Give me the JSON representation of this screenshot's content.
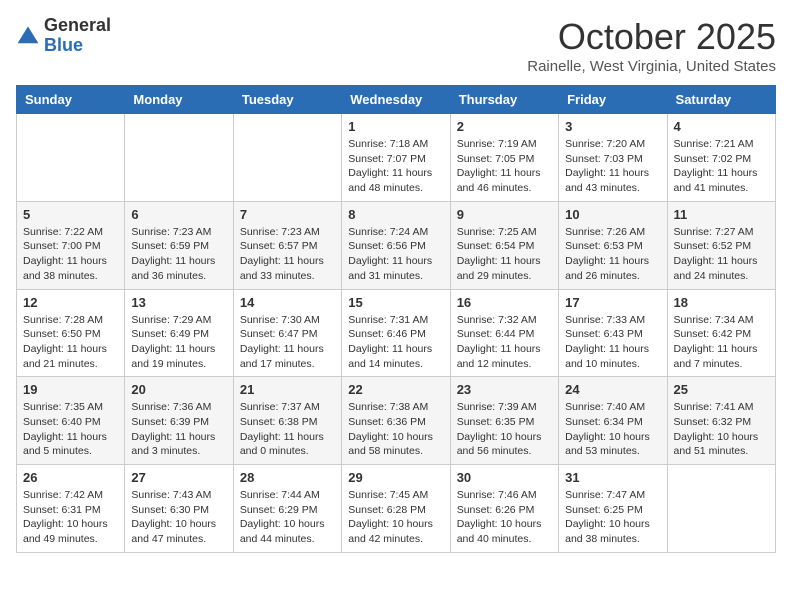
{
  "logo": {
    "general": "General",
    "blue": "Blue"
  },
  "title": "October 2025",
  "location": "Rainelle, West Virginia, United States",
  "days_of_week": [
    "Sunday",
    "Monday",
    "Tuesday",
    "Wednesday",
    "Thursday",
    "Friday",
    "Saturday"
  ],
  "weeks": [
    [
      {
        "day": "",
        "info": ""
      },
      {
        "day": "",
        "info": ""
      },
      {
        "day": "",
        "info": ""
      },
      {
        "day": "1",
        "info": "Sunrise: 7:18 AM\nSunset: 7:07 PM\nDaylight: 11 hours\nand 48 minutes."
      },
      {
        "day": "2",
        "info": "Sunrise: 7:19 AM\nSunset: 7:05 PM\nDaylight: 11 hours\nand 46 minutes."
      },
      {
        "day": "3",
        "info": "Sunrise: 7:20 AM\nSunset: 7:03 PM\nDaylight: 11 hours\nand 43 minutes."
      },
      {
        "day": "4",
        "info": "Sunrise: 7:21 AM\nSunset: 7:02 PM\nDaylight: 11 hours\nand 41 minutes."
      }
    ],
    [
      {
        "day": "5",
        "info": "Sunrise: 7:22 AM\nSunset: 7:00 PM\nDaylight: 11 hours\nand 38 minutes."
      },
      {
        "day": "6",
        "info": "Sunrise: 7:23 AM\nSunset: 6:59 PM\nDaylight: 11 hours\nand 36 minutes."
      },
      {
        "day": "7",
        "info": "Sunrise: 7:23 AM\nSunset: 6:57 PM\nDaylight: 11 hours\nand 33 minutes."
      },
      {
        "day": "8",
        "info": "Sunrise: 7:24 AM\nSunset: 6:56 PM\nDaylight: 11 hours\nand 31 minutes."
      },
      {
        "day": "9",
        "info": "Sunrise: 7:25 AM\nSunset: 6:54 PM\nDaylight: 11 hours\nand 29 minutes."
      },
      {
        "day": "10",
        "info": "Sunrise: 7:26 AM\nSunset: 6:53 PM\nDaylight: 11 hours\nand 26 minutes."
      },
      {
        "day": "11",
        "info": "Sunrise: 7:27 AM\nSunset: 6:52 PM\nDaylight: 11 hours\nand 24 minutes."
      }
    ],
    [
      {
        "day": "12",
        "info": "Sunrise: 7:28 AM\nSunset: 6:50 PM\nDaylight: 11 hours\nand 21 minutes."
      },
      {
        "day": "13",
        "info": "Sunrise: 7:29 AM\nSunset: 6:49 PM\nDaylight: 11 hours\nand 19 minutes."
      },
      {
        "day": "14",
        "info": "Sunrise: 7:30 AM\nSunset: 6:47 PM\nDaylight: 11 hours\nand 17 minutes."
      },
      {
        "day": "15",
        "info": "Sunrise: 7:31 AM\nSunset: 6:46 PM\nDaylight: 11 hours\nand 14 minutes."
      },
      {
        "day": "16",
        "info": "Sunrise: 7:32 AM\nSunset: 6:44 PM\nDaylight: 11 hours\nand 12 minutes."
      },
      {
        "day": "17",
        "info": "Sunrise: 7:33 AM\nSunset: 6:43 PM\nDaylight: 11 hours\nand 10 minutes."
      },
      {
        "day": "18",
        "info": "Sunrise: 7:34 AM\nSunset: 6:42 PM\nDaylight: 11 hours\nand 7 minutes."
      }
    ],
    [
      {
        "day": "19",
        "info": "Sunrise: 7:35 AM\nSunset: 6:40 PM\nDaylight: 11 hours\nand 5 minutes."
      },
      {
        "day": "20",
        "info": "Sunrise: 7:36 AM\nSunset: 6:39 PM\nDaylight: 11 hours\nand 3 minutes."
      },
      {
        "day": "21",
        "info": "Sunrise: 7:37 AM\nSunset: 6:38 PM\nDaylight: 11 hours\nand 0 minutes."
      },
      {
        "day": "22",
        "info": "Sunrise: 7:38 AM\nSunset: 6:36 PM\nDaylight: 10 hours\nand 58 minutes."
      },
      {
        "day": "23",
        "info": "Sunrise: 7:39 AM\nSunset: 6:35 PM\nDaylight: 10 hours\nand 56 minutes."
      },
      {
        "day": "24",
        "info": "Sunrise: 7:40 AM\nSunset: 6:34 PM\nDaylight: 10 hours\nand 53 minutes."
      },
      {
        "day": "25",
        "info": "Sunrise: 7:41 AM\nSunset: 6:32 PM\nDaylight: 10 hours\nand 51 minutes."
      }
    ],
    [
      {
        "day": "26",
        "info": "Sunrise: 7:42 AM\nSunset: 6:31 PM\nDaylight: 10 hours\nand 49 minutes."
      },
      {
        "day": "27",
        "info": "Sunrise: 7:43 AM\nSunset: 6:30 PM\nDaylight: 10 hours\nand 47 minutes."
      },
      {
        "day": "28",
        "info": "Sunrise: 7:44 AM\nSunset: 6:29 PM\nDaylight: 10 hours\nand 44 minutes."
      },
      {
        "day": "29",
        "info": "Sunrise: 7:45 AM\nSunset: 6:28 PM\nDaylight: 10 hours\nand 42 minutes."
      },
      {
        "day": "30",
        "info": "Sunrise: 7:46 AM\nSunset: 6:26 PM\nDaylight: 10 hours\nand 40 minutes."
      },
      {
        "day": "31",
        "info": "Sunrise: 7:47 AM\nSunset: 6:25 PM\nDaylight: 10 hours\nand 38 minutes."
      },
      {
        "day": "",
        "info": ""
      }
    ]
  ]
}
